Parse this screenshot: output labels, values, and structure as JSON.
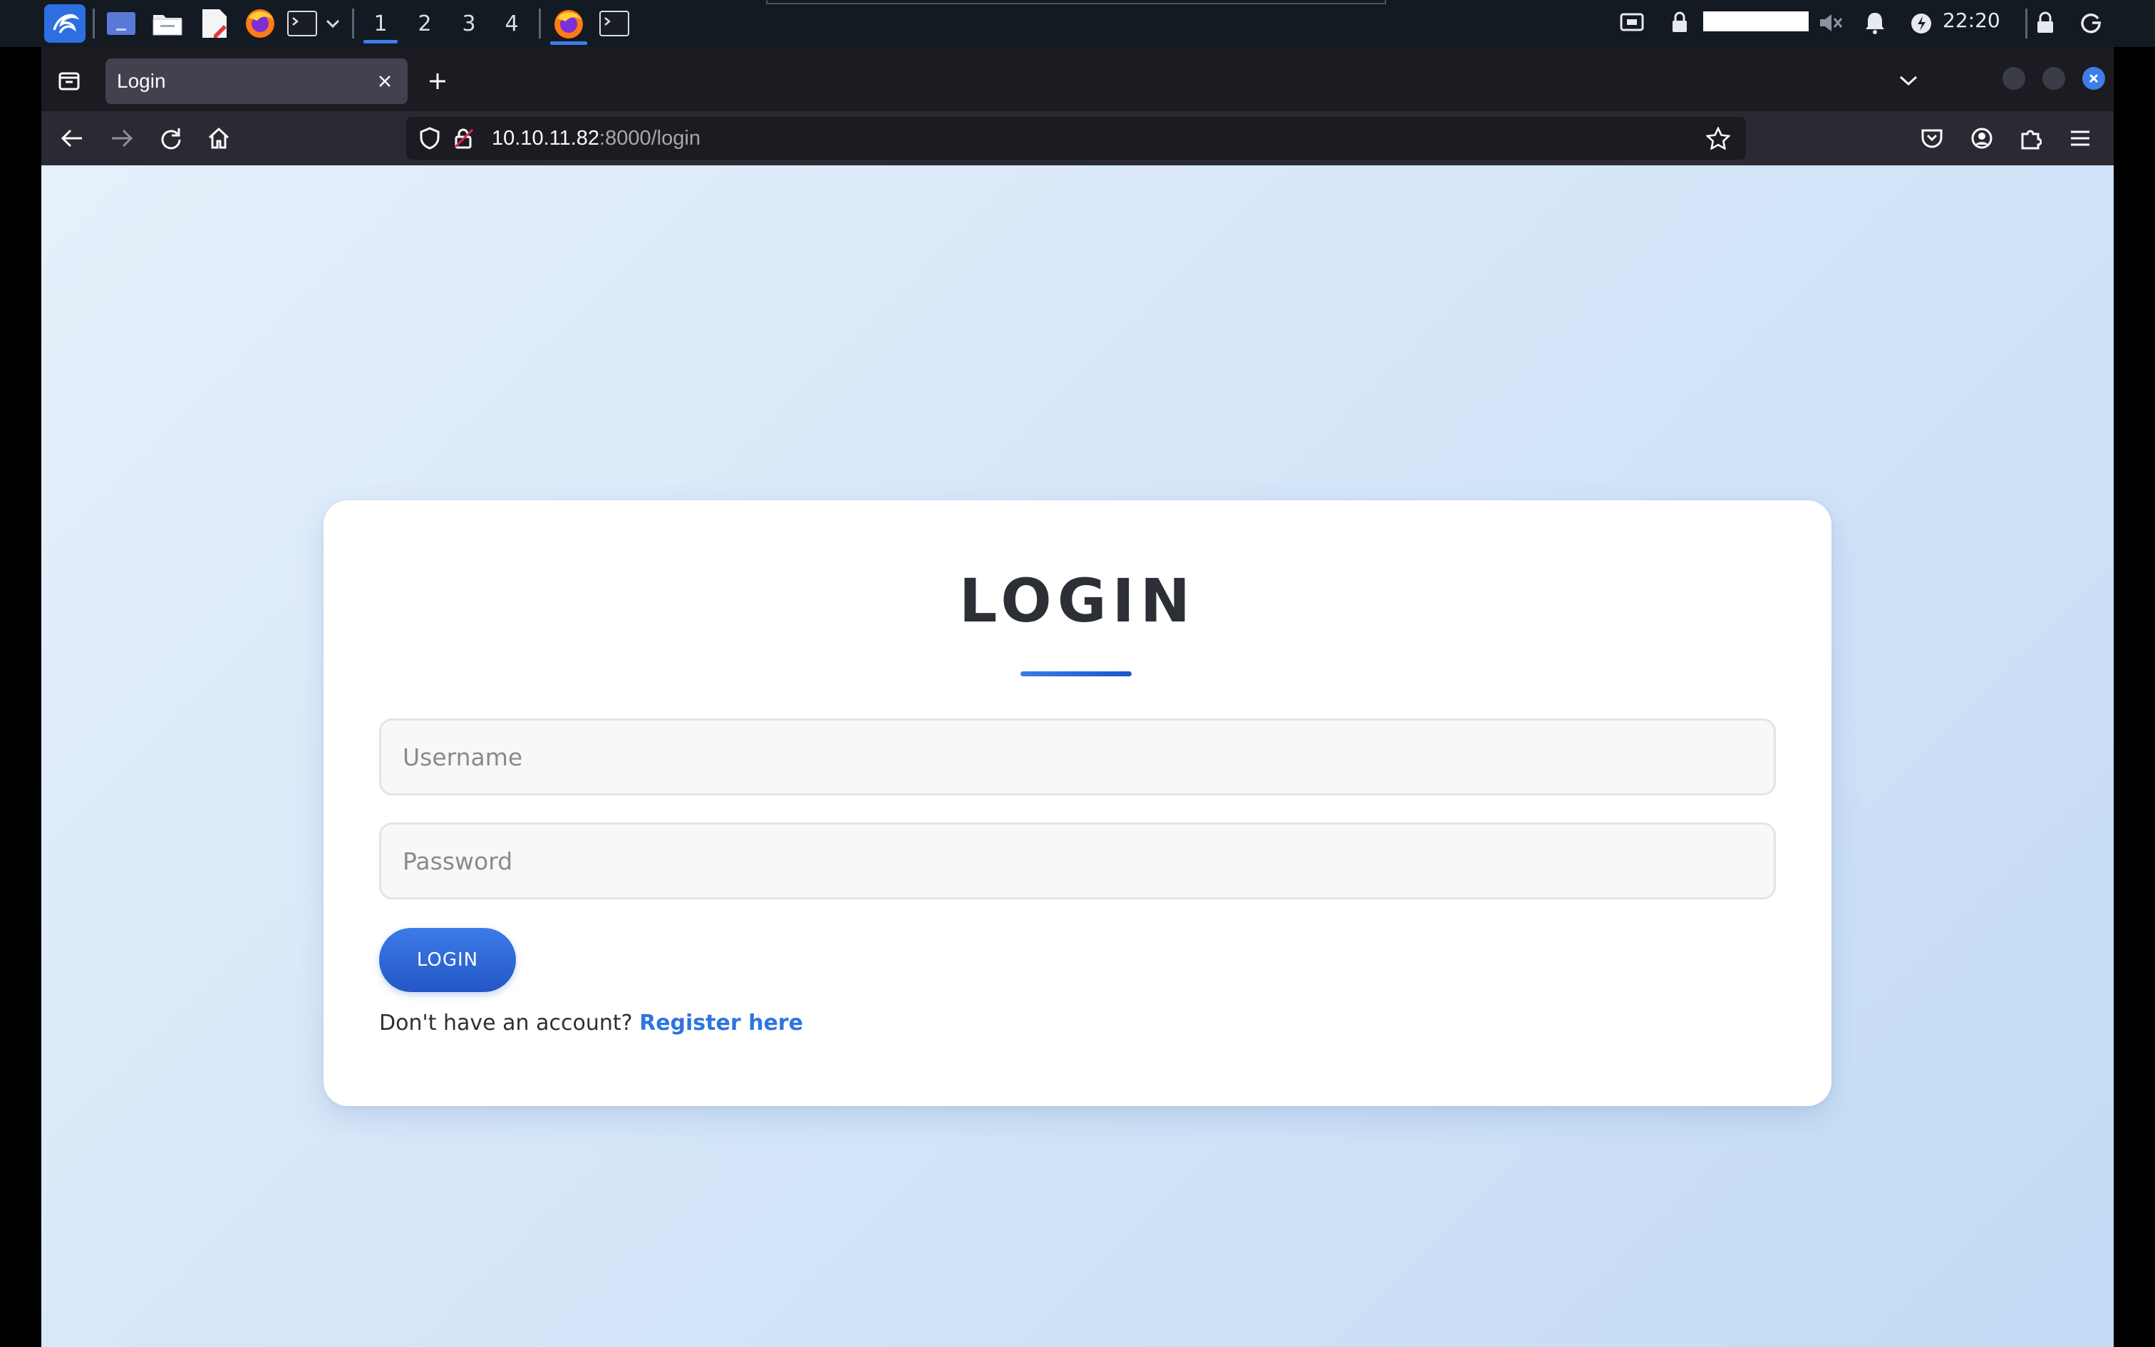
{
  "taskbar": {
    "workspaces": [
      "1",
      "2",
      "3",
      "4"
    ],
    "active_workspace": "1",
    "clock": "22:20",
    "icons": [
      "kali-menu-icon",
      "desktop-icon",
      "file-manager-icon",
      "text-editor-icon",
      "firefox-icon",
      "terminal-icon",
      "volume-muted-icon",
      "notifications-icon",
      "power-icon",
      "lock-icon",
      "logout-icon"
    ]
  },
  "browser": {
    "tab": {
      "title": "Login"
    },
    "url": {
      "host": "10.10.11.82",
      "rest": ":8000/login"
    }
  },
  "page": {
    "title": "LOGIN",
    "username_placeholder": "Username",
    "password_placeholder": "Password",
    "login_button": "LOGIN",
    "register_prompt": "Don't have an account?",
    "register_link": "Register here"
  },
  "colors": {
    "accent": "#3b7be8",
    "link": "#2f74e0",
    "panel_bg": "#141a22",
    "tab_active": "#42414d"
  }
}
